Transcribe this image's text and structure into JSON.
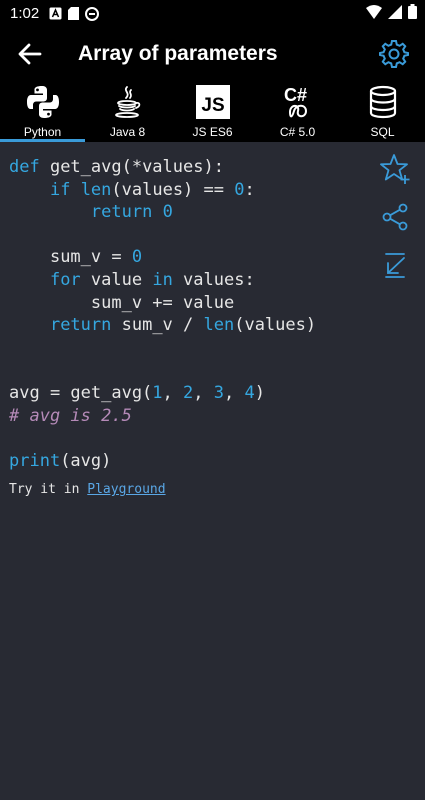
{
  "status_bar": {
    "time": "1:02"
  },
  "app_bar": {
    "title": "Array of parameters",
    "back_icon": "arrow-back-icon",
    "settings_icon": "gear-icon"
  },
  "tabs": [
    {
      "label": "Python",
      "icon": "python-logo-icon",
      "active": true
    },
    {
      "label": "Java 8",
      "icon": "java-logo-icon",
      "active": false
    },
    {
      "label": "JS ES6",
      "icon": "js-logo-icon",
      "active": false
    },
    {
      "label": "C# 5.0",
      "icon": "csharp-logo-icon",
      "active": false
    },
    {
      "label": "SQL",
      "icon": "database-icon",
      "active": false
    }
  ],
  "code": {
    "line1": {
      "kw": "def",
      "rest": " get_avg(*values):"
    },
    "line2": {
      "indent": "    ",
      "kw": "if",
      "sp": " ",
      "fn": "len",
      "rest": "(values) == ",
      "num": "0",
      "end": ":"
    },
    "line3": {
      "indent": "        ",
      "kw": "return",
      "sp": " ",
      "num": "0"
    },
    "line5": {
      "indent": "    ",
      "text": "sum_v = ",
      "num": "0"
    },
    "line6": {
      "indent": "    ",
      "kw": "for",
      "mid": " value ",
      "kw2": "in",
      "rest": " values:"
    },
    "line7": {
      "indent": "        ",
      "text": "sum_v += value"
    },
    "line8": {
      "indent": "    ",
      "kw": "return",
      "text": " sum_v / ",
      "fn": "len",
      "rest": "(values)"
    },
    "line11": {
      "text": "avg = get_avg(",
      "n1": "1",
      "c1": ", ",
      "n2": "2",
      "c2": ", ",
      "n3": "3",
      "c3": ", ",
      "n4": "4",
      "end": ")"
    },
    "line12": {
      "comment": "# avg is 2.5"
    },
    "line14": {
      "fn": "print",
      "rest": "(avg)"
    }
  },
  "try_it": {
    "prefix": "Try it in ",
    "link": "Playground"
  },
  "side_actions": [
    "star-add-icon",
    "share-icon",
    "download-icon"
  ],
  "colors": {
    "accent": "#3a9bd9",
    "background": "#282a33",
    "keyword": "#35a7e0",
    "comment": "#b58ab8"
  }
}
